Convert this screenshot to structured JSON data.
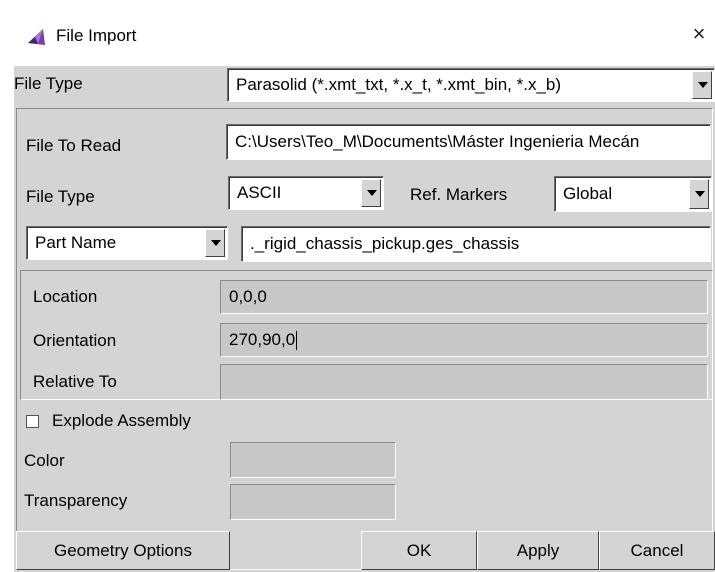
{
  "window": {
    "title": "File Import",
    "close_glyph": "×"
  },
  "file_type": {
    "label": "File Type",
    "value": "Parasolid (*.xmt_txt, *.x_t, *.xmt_bin, *.x_b)"
  },
  "file_to_read": {
    "label": "File To Read",
    "value": "C:\\Users\\Teo_M\\Documents\\Máster Ingenieria Mecán"
  },
  "format": {
    "label": "File Type",
    "value": "ASCII"
  },
  "ref_markers": {
    "label": "Ref. Markers",
    "value": "Global"
  },
  "part_name": {
    "selector": "Part Name",
    "value": "._rigid_chassis_pickup.ges_chassis"
  },
  "location": {
    "label": "Location",
    "value": "0,0,0"
  },
  "orientation": {
    "label": "Orientation",
    "value": "270,90,0"
  },
  "relative_to": {
    "label": "Relative To",
    "value": ""
  },
  "explode": {
    "label": "Explode Assembly",
    "checked": false
  },
  "color": {
    "label": "Color",
    "value": ""
  },
  "transparency": {
    "label": "Transparency",
    "value": ""
  },
  "buttons": {
    "geometry": "Geometry Options",
    "ok": "OK",
    "apply": "Apply",
    "cancel": "Cancel"
  },
  "icons": {
    "app": "adams-view-icon",
    "close": "close-icon",
    "dropdown": "chevron-down-icon"
  },
  "colors": {
    "panel": "#d4d4d4",
    "field": "#ffffff",
    "disabled_field": "#c8c8c8",
    "icon_purple": "#7a3aa8"
  }
}
